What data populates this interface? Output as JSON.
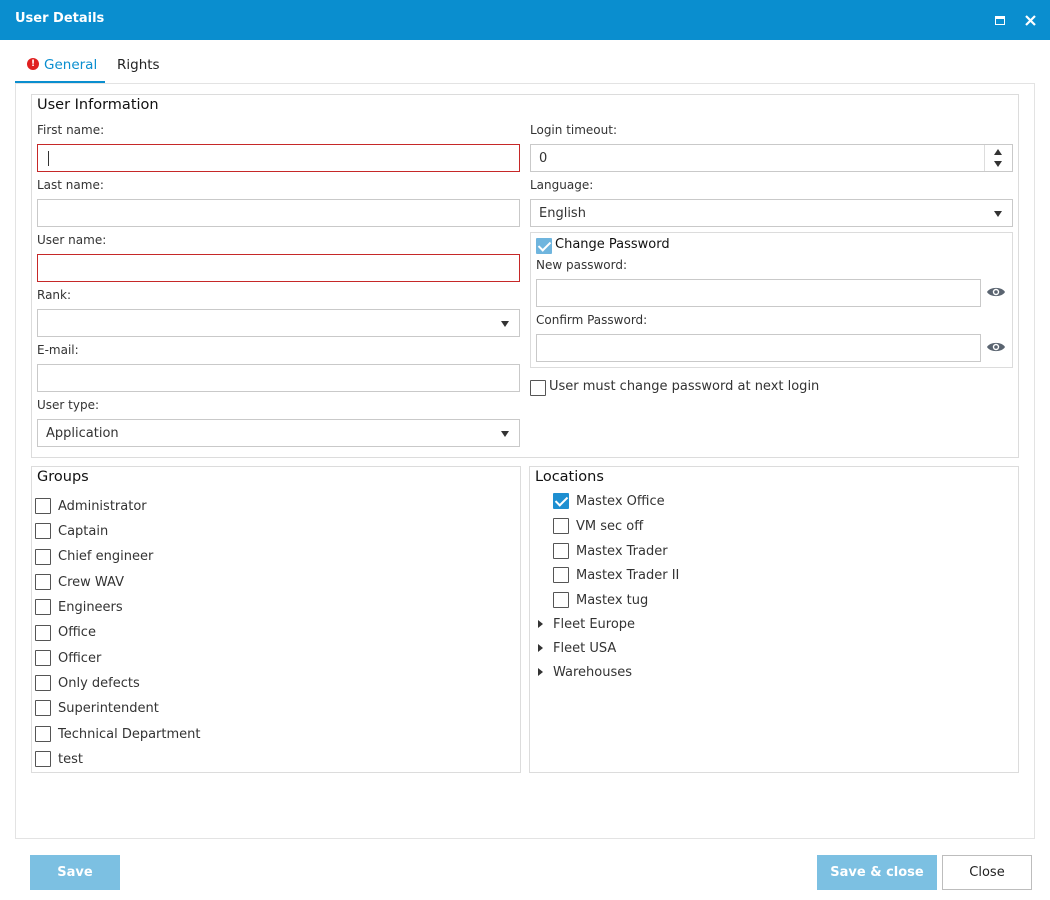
{
  "window": {
    "title": "User Details"
  },
  "tabs": [
    {
      "label": "General",
      "has_error": true
    },
    {
      "label": "Rights"
    }
  ],
  "user_info": {
    "section_title": "User Information",
    "first_name": {
      "label": "First name:",
      "value": ""
    },
    "last_name": {
      "label": "Last name:",
      "value": ""
    },
    "user_name": {
      "label": "User name:",
      "value": ""
    },
    "rank": {
      "label": "Rank:",
      "value": ""
    },
    "email": {
      "label": "E-mail:",
      "value": ""
    },
    "user_type": {
      "label": "User type:",
      "value": "Application"
    },
    "login_timeout": {
      "label": "Login timeout:",
      "value": "0"
    },
    "language": {
      "label": "Language:",
      "value": "English"
    },
    "change_password": {
      "label": "Change Password",
      "checked": true,
      "new_password_label": "New password:",
      "confirm_password_label": "Confirm Password:"
    },
    "must_change": {
      "label": "User must change password at next login",
      "checked": false
    }
  },
  "groups": {
    "title": "Groups",
    "items": [
      {
        "label": "Administrator",
        "checked": false
      },
      {
        "label": "Captain",
        "checked": false
      },
      {
        "label": "Chief engineer",
        "checked": false
      },
      {
        "label": "Crew WAV",
        "checked": false
      },
      {
        "label": "Engineers",
        "checked": false
      },
      {
        "label": "Office",
        "checked": false
      },
      {
        "label": "Officer",
        "checked": false
      },
      {
        "label": "Only defects",
        "checked": false
      },
      {
        "label": "Superintendent",
        "checked": false
      },
      {
        "label": "Technical Department",
        "checked": false
      },
      {
        "label": "test",
        "checked": false
      }
    ]
  },
  "locations": {
    "title": "Locations",
    "items": [
      {
        "label": "Mastex Office",
        "checked": true
      },
      {
        "label": "VM sec off",
        "checked": false
      },
      {
        "label": "Mastex Trader",
        "checked": false
      },
      {
        "label": "Mastex Trader II",
        "checked": false
      },
      {
        "label": "Mastex tug",
        "checked": false
      }
    ],
    "folders": [
      {
        "label": "Fleet Europe"
      },
      {
        "label": "Fleet USA"
      },
      {
        "label": "Warehouses"
      }
    ]
  },
  "buttons": {
    "save": "Save",
    "save_close": "Save & close",
    "close": "Close"
  },
  "colors": {
    "accent": "#0a8ecf",
    "error": "#c62828",
    "button_disabled": "#7cc0e2"
  }
}
